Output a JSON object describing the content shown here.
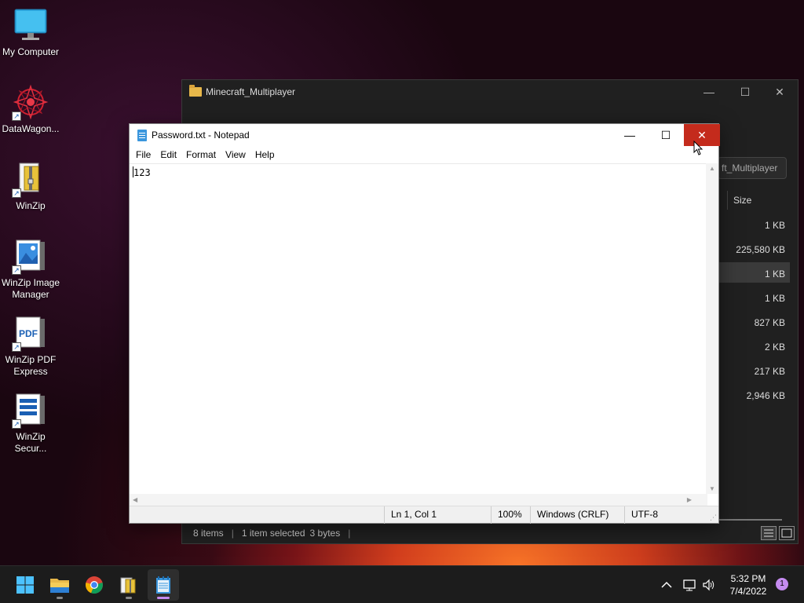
{
  "desktop": {
    "icons": [
      {
        "label": "My Computer",
        "icon": "monitor-icon"
      },
      {
        "label": "DataWagon...",
        "icon": "datawagon-icon"
      },
      {
        "label": "WinZip",
        "icon": "winzip-icon"
      },
      {
        "label": "WinZip Image Manager",
        "icon": "winzip-image-icon"
      },
      {
        "label": "WinZip PDF Express",
        "icon": "winzip-pdf-icon"
      },
      {
        "label": "WinZip Secur...",
        "icon": "winzip-secure-icon"
      }
    ],
    "pdf_badge": "PDF"
  },
  "explorer": {
    "title": "Minecraft_Multiplayer",
    "address_fragment": "ft_Multiplayer",
    "column_size": "Size",
    "sizes": [
      "1 KB",
      "225,580 KB",
      "1 KB",
      "1 KB",
      "827 KB",
      "2 KB",
      "217 KB",
      "2,946 KB"
    ],
    "status": {
      "items": "8 items",
      "selected": "1 item selected",
      "bytes": "3 bytes"
    },
    "controls": {
      "minimize": "—",
      "maximize": "☐",
      "close": "✕"
    }
  },
  "notepad": {
    "title": "Password.txt - Notepad",
    "menu": [
      "File",
      "Edit",
      "Format",
      "View",
      "Help"
    ],
    "content": "123",
    "controls": {
      "minimize": "—",
      "maximize": "☐",
      "close": "✕"
    },
    "status": {
      "position": "Ln 1, Col 1",
      "zoom": "100%",
      "line_ending": "Windows (CRLF)",
      "encoding": "UTF-8"
    }
  },
  "taskbar": {
    "apps": [
      "start-icon",
      "file-explorer-icon",
      "chrome-icon",
      "winzip-icon",
      "notepad-icon"
    ],
    "clock": {
      "time": "5:32 PM",
      "date": "7/4/2022"
    },
    "notification_count": "1",
    "colors": {
      "accent": "#c58bf0",
      "close_red": "#c42b1c"
    }
  }
}
